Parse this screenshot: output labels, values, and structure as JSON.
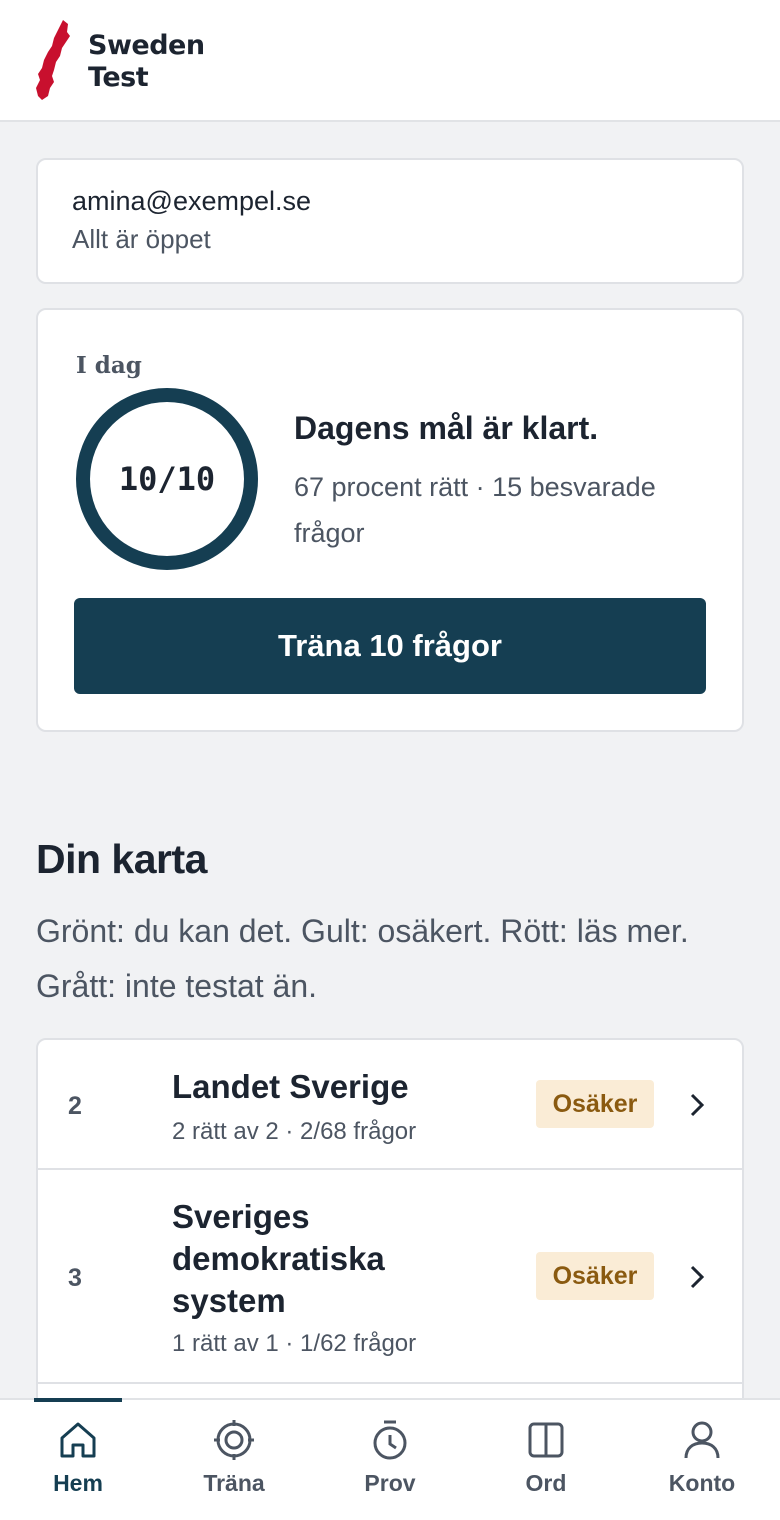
{
  "header": {
    "brand_line1": "Sweden",
    "brand_line2": "Test",
    "logo_icon": "sweden-map-icon",
    "logo_color": "#c8102e"
  },
  "account": {
    "email": "amina@exempel.se",
    "status": "Allt är öppet"
  },
  "today": {
    "label": "I dag",
    "progress_text": "10/10",
    "progress_fraction": 1.0,
    "goal_title": "Dagens mål är klart.",
    "stats": "67 procent rätt · 15 besvarade frågor",
    "button_label": "Träna 10 frågor"
  },
  "map": {
    "title": "Din karta",
    "description": "Grönt: du kan det. Gult: osäkert. Rött: läs mer. Grått: inte testat än."
  },
  "topics": [
    {
      "number": "2",
      "name": "Landet Sverige",
      "meta": "2 rätt av 2 · 2/68 frågor",
      "badge": "Osäker"
    },
    {
      "number": "3",
      "name": "Sveriges demokratiska system",
      "meta": "1 rätt av 1 · 1/62 frågor",
      "badge": "Osäker"
    }
  ],
  "nav": [
    {
      "label": "Hem",
      "icon": "home-icon",
      "active": true
    },
    {
      "label": "Träna",
      "icon": "target-icon",
      "active": false
    },
    {
      "label": "Prov",
      "icon": "timer-icon",
      "active": false
    },
    {
      "label": "Ord",
      "icon": "book-icon",
      "active": false
    },
    {
      "label": "Konto",
      "icon": "user-icon",
      "active": false
    }
  ],
  "colors": {
    "primary": "#153e52",
    "badge_bg": "#faecd6",
    "badge_text": "#8a5a10",
    "background": "#f1f2f4"
  }
}
